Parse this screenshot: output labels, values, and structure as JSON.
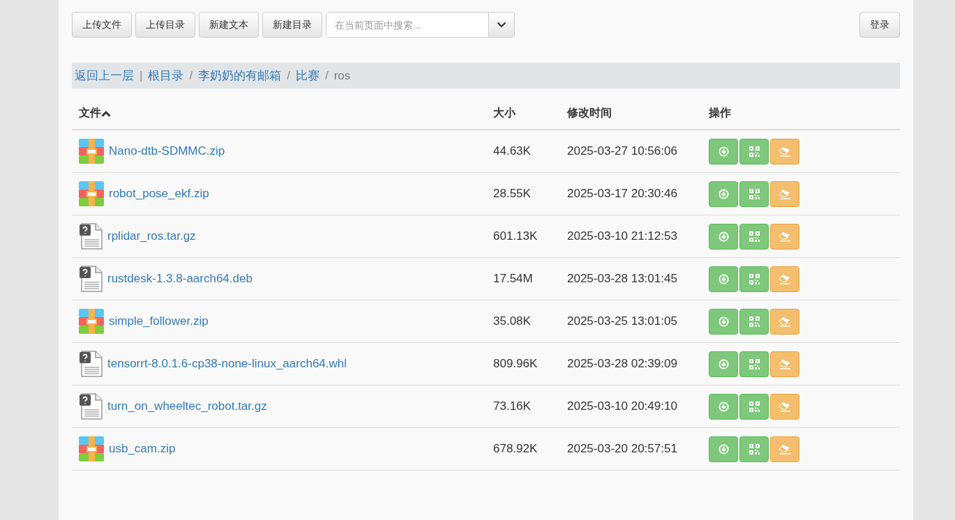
{
  "toolbar": {
    "buttons": [
      "上传文件",
      "上传目录",
      "新建文本",
      "新建目录"
    ],
    "search": {
      "placeholder": "在当前页面中搜索..."
    },
    "login": "登录"
  },
  "breadcrumb": [
    {
      "label": "返回上一层",
      "kind": "link"
    },
    {
      "label": "|",
      "kind": "separator"
    },
    {
      "label": "根目录",
      "kind": "link"
    },
    {
      "label": "/",
      "kind": "separator"
    },
    {
      "label": "李奶奶的有邮箱",
      "kind": "link"
    },
    {
      "label": "/",
      "kind": "separator"
    },
    {
      "label": "比赛",
      "kind": "link"
    },
    {
      "label": "/",
      "kind": "separator"
    },
    {
      "label": "ros",
      "kind": "current"
    }
  ],
  "table": {
    "columns": [
      "文件",
      "大小",
      "修改时间",
      "操作"
    ],
    "rows": [
      {
        "name": "Nano-dtb-SDMMC.zip",
        "kind": "archive",
        "size": "44.63K",
        "modified": "2025-03-27 10:56:06"
      },
      {
        "name": "robot_pose_ekf.zip",
        "kind": "archive",
        "size": "28.55K",
        "modified": "2025-03-17 20:30:46"
      },
      {
        "name": "rplidar_ros.tar.gz",
        "kind": "unknown",
        "size": "601.13K",
        "modified": "2025-03-10 21:12:53"
      },
      {
        "name": "rustdesk-1.3.8-aarch64.deb",
        "kind": "unknown",
        "size": "17.54M",
        "modified": "2025-03-28 13:01:45"
      },
      {
        "name": "simple_follower.zip",
        "kind": "archive",
        "size": "35.08K",
        "modified": "2025-03-25 13:01:05"
      },
      {
        "name": "tensorrt-8.0.1.6-cp38-none-linux_aarch64.whl",
        "kind": "unknown",
        "size": "809.96K",
        "modified": "2025-03-28 02:39:09"
      },
      {
        "name": "turn_on_wheeltec_robot.tar.gz",
        "kind": "unknown",
        "size": "73.16K",
        "modified": "2025-03-10 20:49:10"
      },
      {
        "name": "usb_cam.zip",
        "kind": "archive",
        "size": "678.92K",
        "modified": "2025-03-20 20:57:51"
      }
    ]
  }
}
